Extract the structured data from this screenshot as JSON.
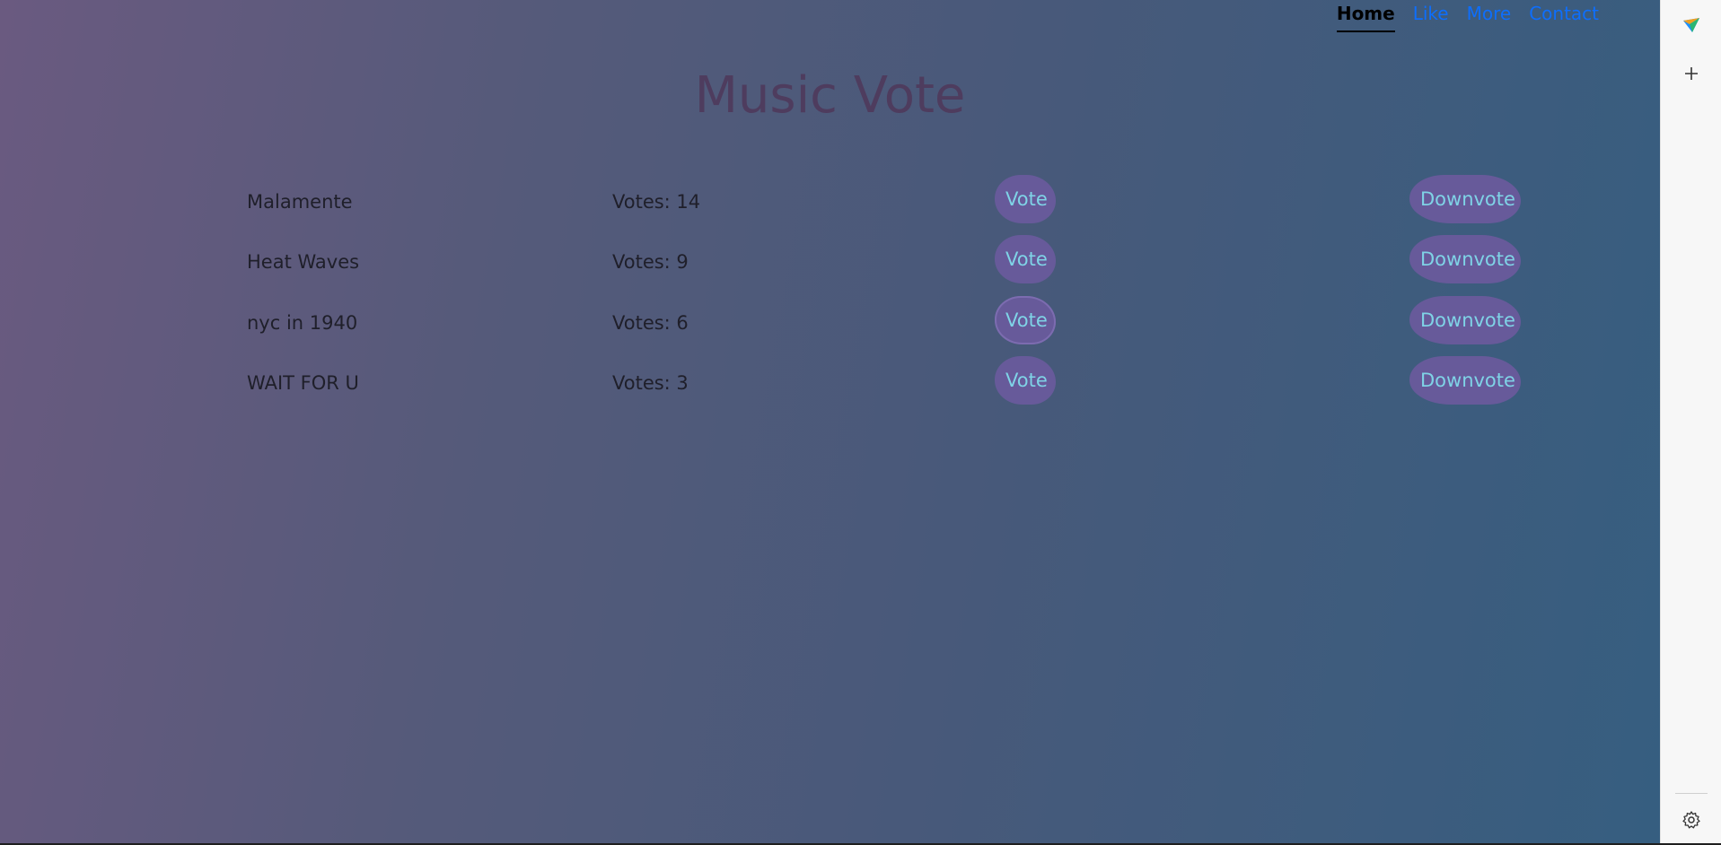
{
  "nav": {
    "items": [
      {
        "label": "Home",
        "active": true
      },
      {
        "label": "Like",
        "active": false
      },
      {
        "label": "More",
        "active": false
      },
      {
        "label": "Contact",
        "active": false
      }
    ]
  },
  "title": "Music Vote",
  "songs": [
    {
      "name": "Malamente",
      "votes": "Votes: 14"
    },
    {
      "name": "Heat Waves",
      "votes": "Votes: 9"
    },
    {
      "name": "nyc in 1940",
      "votes": "Votes: 6"
    },
    {
      "name": "WAIT FOR U",
      "votes": "Votes: 3"
    }
  ],
  "buttons": {
    "vote_label": "Vote",
    "downvote_label": "Downvote"
  },
  "colors": {
    "button_bg": "#675a9a",
    "button_text": "#7fd3e6",
    "nav_link": "#0d6efd",
    "title": "#4e3c5e"
  },
  "sidebar": {
    "icons": [
      "send-icon",
      "plus-icon",
      "gear-icon"
    ]
  }
}
